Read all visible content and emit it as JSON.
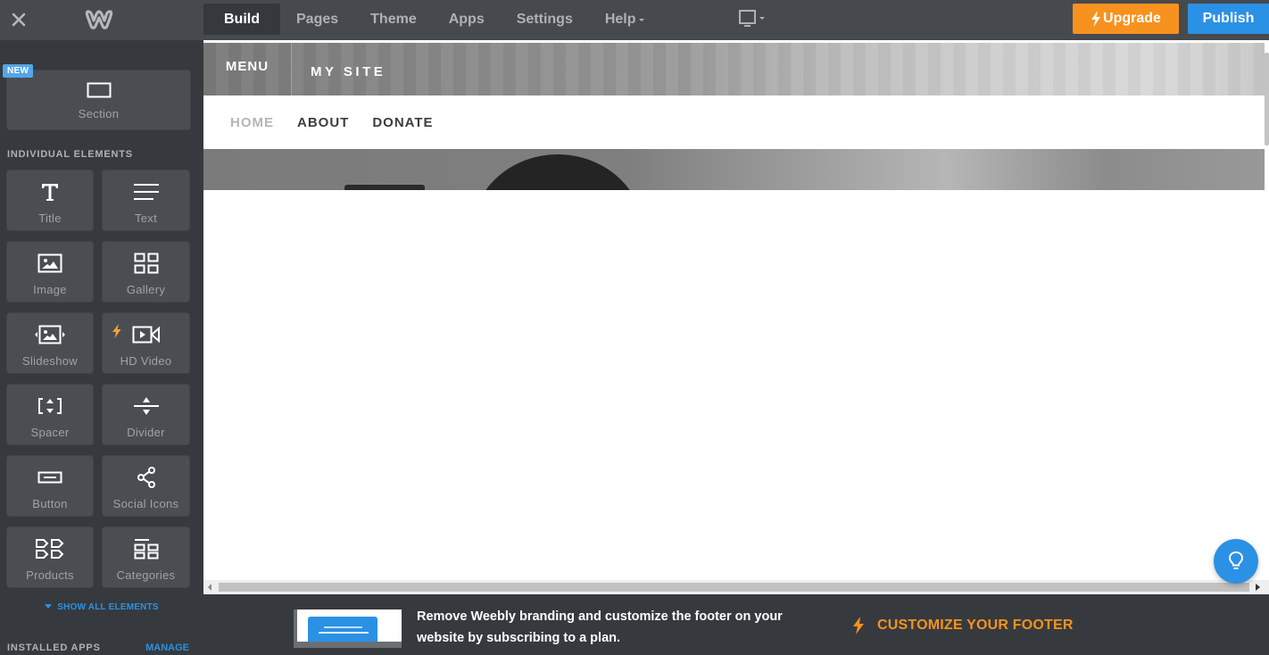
{
  "topbar": {
    "close_icon": "close-icon",
    "logo": "weebly-logo",
    "nav": [
      {
        "label": "Build",
        "active": true
      },
      {
        "label": "Pages",
        "active": false
      },
      {
        "label": "Theme",
        "active": false
      },
      {
        "label": "Apps",
        "active": false
      },
      {
        "label": "Settings",
        "active": false
      },
      {
        "label": "Help",
        "active": false,
        "dropdown": true
      }
    ],
    "device_icon": "desktop-monitor-icon",
    "upgrade_label": "Upgrade",
    "publish_label": "Publish",
    "colors": {
      "upgrade": "#f7921e",
      "publish": "#2b91e4",
      "bar": "#464a4f"
    }
  },
  "sidebar": {
    "new_badge": "NEW",
    "section_tile": {
      "label": "Section",
      "icon": "section-icon"
    },
    "individual_title": "INDIVIDUAL ELEMENTS",
    "elements": [
      {
        "label": "Title",
        "icon": "title-icon"
      },
      {
        "label": "Text",
        "icon": "text-icon"
      },
      {
        "label": "Image",
        "icon": "image-icon"
      },
      {
        "label": "Gallery",
        "icon": "gallery-icon"
      },
      {
        "label": "Slideshow",
        "icon": "slideshow-icon"
      },
      {
        "label": "HD Video",
        "icon": "video-icon",
        "premium": true
      },
      {
        "label": "Spacer",
        "icon": "spacer-icon"
      },
      {
        "label": "Divider",
        "icon": "divider-icon"
      },
      {
        "label": "Button",
        "icon": "button-icon"
      },
      {
        "label": "Social Icons",
        "icon": "share-icon"
      },
      {
        "label": "Products",
        "icon": "products-icon"
      },
      {
        "label": "Categories",
        "icon": "categories-icon"
      }
    ],
    "show_all": "SHOW ALL ELEMENTS",
    "installed_apps_title": "INSTALLED APPS",
    "manage_label": "MANAGE"
  },
  "site": {
    "menu_label": "MENU",
    "site_title": "MY SITE",
    "nav": [
      {
        "label": "HOME",
        "current": true
      },
      {
        "label": "ABOUT",
        "current": false
      },
      {
        "label": "DONATE",
        "current": false
      }
    ]
  },
  "promo": {
    "text": "Remove Weebly branding and customize the footer on your website by subscribing to a plan.",
    "cta": "CUSTOMIZE YOUR FOOTER",
    "cta_color": "#f7921e"
  },
  "help_fab_icon": "lightbulb-icon"
}
